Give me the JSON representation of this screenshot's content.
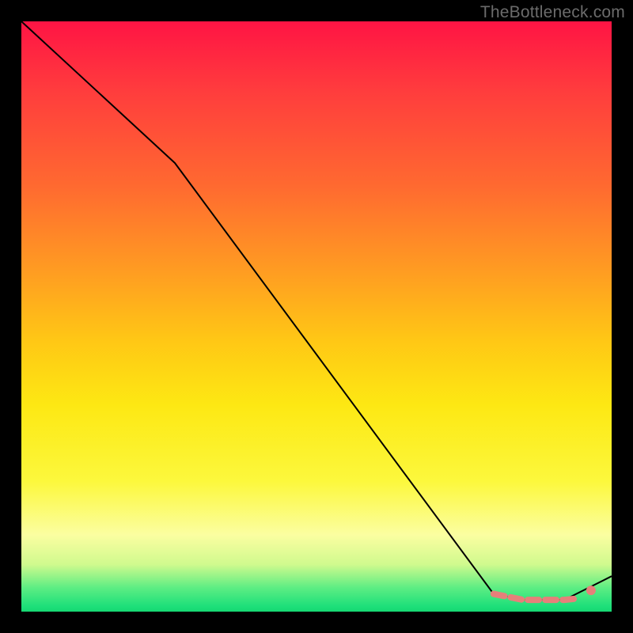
{
  "watermark": "TheBottleneck.com",
  "chart_data": {
    "type": "line",
    "title": "",
    "xlabel": "",
    "ylabel": "",
    "xlim": [
      0,
      100
    ],
    "ylim": [
      0,
      100
    ],
    "grid": false,
    "series": [
      {
        "name": "bottleneck-curve",
        "x": [
          0,
          26,
          80,
          85,
          92,
          100
        ],
        "y": [
          100,
          76,
          3,
          2,
          2,
          6
        ],
        "stroke": "#000000",
        "width": 2
      },
      {
        "name": "highlight-segment",
        "x": [
          80,
          83,
          85,
          88,
          90,
          92,
          94
        ],
        "y": [
          3,
          2.4,
          2,
          2,
          2,
          2,
          2.2
        ],
        "stroke": "#e6807a",
        "width": 8,
        "dash": "14 8"
      }
    ],
    "points": [
      {
        "name": "highlight-dot",
        "x": 96.5,
        "y": 3.6,
        "r": 6,
        "fill": "#e6807a"
      }
    ],
    "gradient_stops": [
      {
        "pos": 0,
        "color": "#ff1444"
      },
      {
        "pos": 50,
        "color": "#ffd418"
      },
      {
        "pos": 80,
        "color": "#fcf94a"
      },
      {
        "pos": 100,
        "color": "#16d873"
      }
    ]
  }
}
